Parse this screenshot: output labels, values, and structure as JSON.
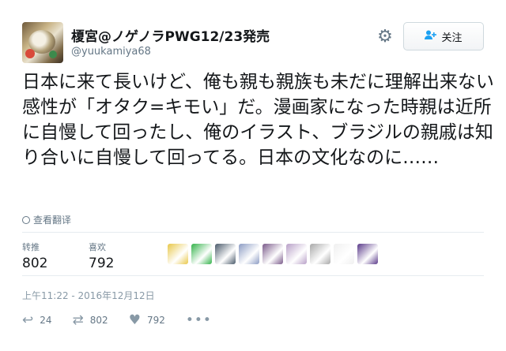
{
  "user": {
    "display_name": "榎宮@ノゲノラPWG12/23発売",
    "handle": "@yuukamiya68"
  },
  "follow_button": {
    "label": "关注",
    "icon": "person-plus-icon"
  },
  "settings_icon": "gear-icon",
  "tweet": {
    "text": "日本に来て長いけど、俺も親も親族も未だに理解出来ない感性が「オタク=キモい」だ。漫画家になった時親は近所に自慢して回ったし、俺のイラスト、ブラジルの親戚は知り合いに自慢して回ってる。日本の文化なのに……"
  },
  "translate": {
    "label": "查看翻译",
    "icon": "globe-icon"
  },
  "stats": {
    "retweets_label": "转推",
    "retweets": "802",
    "likes_label": "喜欢",
    "likes": "792"
  },
  "liker_avatar_colors": [
    "#e8c84a",
    "#33b24a",
    "#4a5a6a",
    "#8c9cc4",
    "#7a5a8a",
    "#b8a0c8",
    "#a8a8a8",
    "#f0f0f0",
    "#5a3a8a"
  ],
  "timestamp": "上午11:22 - 2016年12月12日",
  "actions": {
    "reply_count": "24",
    "retweet_count": "802",
    "like_count": "792"
  }
}
